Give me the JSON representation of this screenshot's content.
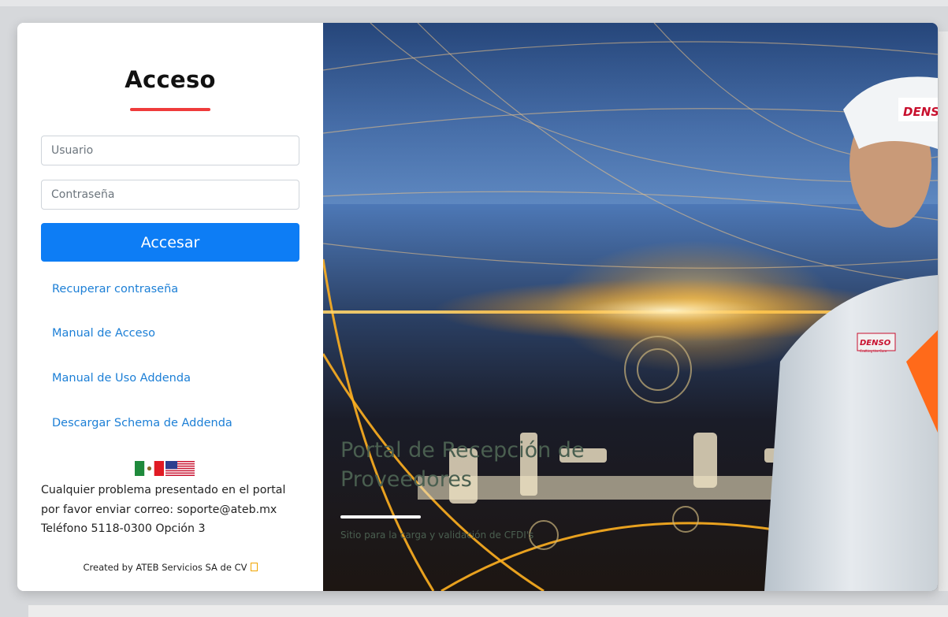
{
  "login": {
    "title": "Acceso",
    "username_placeholder": "Usuario",
    "password_placeholder": "Contraseña",
    "submit_label": "Accesar",
    "accent_color": "#ef3b3b",
    "button_color": "#0d7df5"
  },
  "links": {
    "recover": "Recuperar contraseña",
    "access_manual": "Manual de Acceso",
    "addenda_manual": "Manual de Uso Addenda",
    "addenda_schema": "Descargar Schema de Addenda"
  },
  "languages": [
    {
      "icon": "mexico-flag-icon"
    },
    {
      "icon": "usa-flag-icon"
    }
  ],
  "support": {
    "line1": "Cualquier problema presentado en el portal",
    "line2": "por favor enviar correo: soporte@ateb.mx",
    "line3": "Teléfono 5118-0300 Opción 3"
  },
  "footer": {
    "credit": "Created by ATEB Servicios SA de CV"
  },
  "hero": {
    "title": "Portal de Recepción de Proveedores",
    "subtitle": "Sitio para la carga y validación de CFDI's",
    "brand_badge": "DENSO",
    "brand_tagline": "Crafting the Core"
  }
}
